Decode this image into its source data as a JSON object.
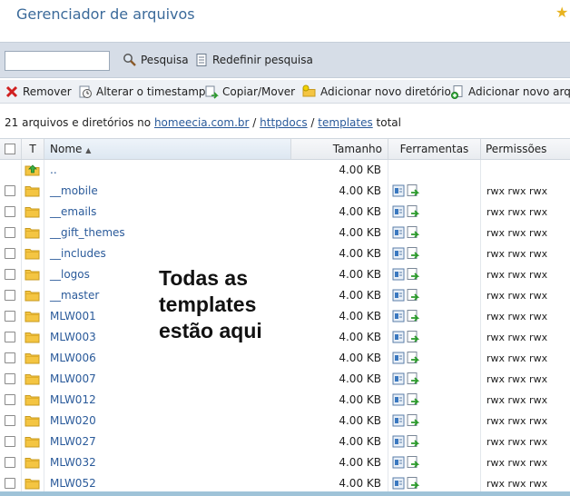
{
  "header": {
    "title": "Gerenciador de arquivos"
  },
  "search": {
    "value": "",
    "search_label": "Pesquisa",
    "reset_label": "Redefinir pesquisa"
  },
  "actions": {
    "remove": "Remover",
    "timestamp": "Alterar o timestamp",
    "copy_move": "Copiar/Mover",
    "add_dir": "Adicionar novo diretório",
    "add_file": "Adicionar novo arqui"
  },
  "summary": {
    "prefix": "21 arquivos e diretórios no",
    "path1": "homeecia.com.br",
    "sep1": "/",
    "path2": "httpdocs",
    "sep2": "/",
    "path3": "templates",
    "suffix": "total"
  },
  "columns": {
    "type": "T",
    "name": "Nome",
    "size": "Tamanho",
    "tools": "Ferramentas",
    "perms": "Permissões"
  },
  "rows": [
    {
      "name": "..",
      "size": "4.00 KB",
      "perm": "",
      "parent": true
    },
    {
      "name": "__mobile",
      "size": "4.00 KB",
      "perm": "rwx rwx rwx"
    },
    {
      "name": "__emails",
      "size": "4.00 KB",
      "perm": "rwx rwx rwx"
    },
    {
      "name": "__gift_themes",
      "size": "4.00 KB",
      "perm": "rwx rwx rwx"
    },
    {
      "name": "__includes",
      "size": "4.00 KB",
      "perm": "rwx rwx rwx"
    },
    {
      "name": "__logos",
      "size": "4.00 KB",
      "perm": "rwx rwx rwx"
    },
    {
      "name": "__master",
      "size": "4.00 KB",
      "perm": "rwx rwx rwx"
    },
    {
      "name": "MLW001",
      "size": "4.00 KB",
      "perm": "rwx rwx rwx"
    },
    {
      "name": "MLW003",
      "size": "4.00 KB",
      "perm": "rwx rwx rwx"
    },
    {
      "name": "MLW006",
      "size": "4.00 KB",
      "perm": "rwx rwx rwx"
    },
    {
      "name": "MLW007",
      "size": "4.00 KB",
      "perm": "rwx rwx rwx"
    },
    {
      "name": "MLW012",
      "size": "4.00 KB",
      "perm": "rwx rwx rwx"
    },
    {
      "name": "MLW020",
      "size": "4.00 KB",
      "perm": "rwx rwx rwx"
    },
    {
      "name": "MLW027",
      "size": "4.00 KB",
      "perm": "rwx rwx rwx"
    },
    {
      "name": "MLW032",
      "size": "4.00 KB",
      "perm": "rwx rwx rwx"
    },
    {
      "name": "MLW052",
      "size": "4.00 KB",
      "perm": "rwx rwx rwx"
    }
  ],
  "overlay_text": [
    "Todas as",
    "templates",
    "estão aqui"
  ],
  "colors": {
    "link": "#2a5a9a",
    "title": "#3b6a9a",
    "folder": "#f4c542",
    "toolbar": "#d6dde7"
  }
}
